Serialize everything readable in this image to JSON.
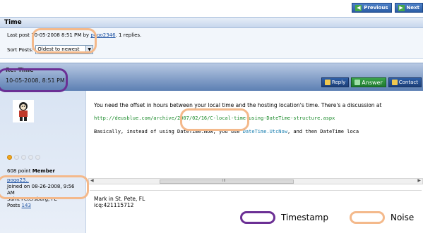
{
  "nav": {
    "previous_label": "Previous",
    "next_label": "Next"
  },
  "thread": {
    "title": "Time",
    "last_post_prefix": "Last post ",
    "last_post_date": "10-05-2008 8:51 PM by ",
    "last_post_user": "pogo2346",
    "last_post_suffix": ". 1 replies.",
    "sort_label": "Sort Posts:",
    "sort_value": "Oldest to newest"
  },
  "post": {
    "title": "Re: Time",
    "date": "10-05-2008, 8:51 PM",
    "reply_label": "Reply",
    "answer_label": "Answer",
    "contact_label": "Contact"
  },
  "user": {
    "points_value": "608 point",
    "points_rank": "Member",
    "username": "pogo23..",
    "joined_line1": "Joined on 08-26-2008, 9:56",
    "joined_line2": "AM",
    "location": "Saint Petersburg, FL",
    "posts_label": "Posts",
    "posts_count": "143",
    "stars_filled": 1,
    "stars_total": 5
  },
  "body": {
    "message": "You need the offset in hours between your local time and the hosting location's time.  There's a discussion at",
    "link": "http://deusblue.com/archive/2007/02/16/C-local-time-using-DateTime-structure.aspx",
    "code_prefix": "Basically, instead of using DateTime.Now, you use ",
    "code_kw": "DateTime.UtcNow",
    "code_suffix": ", and then DateTime loca",
    "scroll_center": "III",
    "sig_line1": "Mark in St. Pete, FL",
    "sig_line2": "icq:421115712"
  },
  "legend": {
    "timestamp_label": "Timestamp",
    "noise_label": "Noise"
  },
  "colors": {
    "timestamp": "#6b2f94",
    "noise": "#f4b98b"
  }
}
